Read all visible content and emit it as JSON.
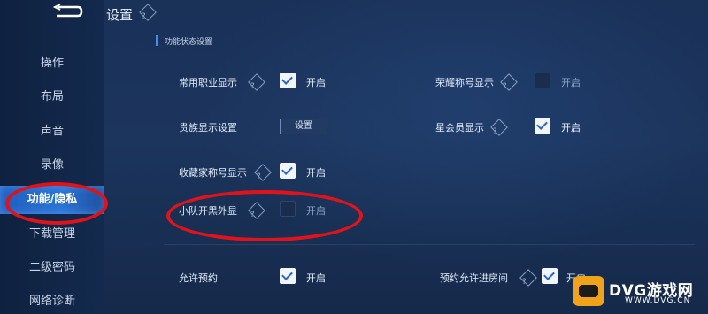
{
  "header": {
    "title": "设置"
  },
  "sidebar": {
    "items": [
      {
        "label": "操作"
      },
      {
        "label": "布局"
      },
      {
        "label": "声音"
      },
      {
        "label": "录像"
      },
      {
        "label": "功能/隐私"
      },
      {
        "label": "下载管理"
      },
      {
        "label": "二级密码"
      },
      {
        "label": "网络诊断"
      }
    ]
  },
  "section": {
    "title": "功能状态设置"
  },
  "rows": {
    "common_job": {
      "label": "常用职业显示",
      "toggle": "开启",
      "checked": true
    },
    "honor_title": {
      "label": "荣耀称号显示",
      "toggle": "开启",
      "checked": false
    },
    "noble": {
      "label": "贵族显示设置",
      "button": "设置"
    },
    "star_member": {
      "label": "星会员显示",
      "toggle": "开启",
      "checked": true
    },
    "collector": {
      "label": "收藏家称号显示",
      "toggle": "开启",
      "checked": true
    },
    "team_blacklist": {
      "label": "小队开黑外显",
      "toggle": "开启",
      "checked": false
    },
    "allow_booking": {
      "label": "允许预约",
      "toggle": "开启",
      "checked": true
    },
    "booking_room": {
      "label": "预约允许进房间",
      "toggle": "开启",
      "checked": true
    }
  },
  "watermark": {
    "brand": "DVG游戏网",
    "url": "WWW.DVG.CN"
  },
  "colors": {
    "accent": "#2a74d6",
    "highlight_circle": "#e1131a",
    "watermark": "#f0a21b"
  }
}
